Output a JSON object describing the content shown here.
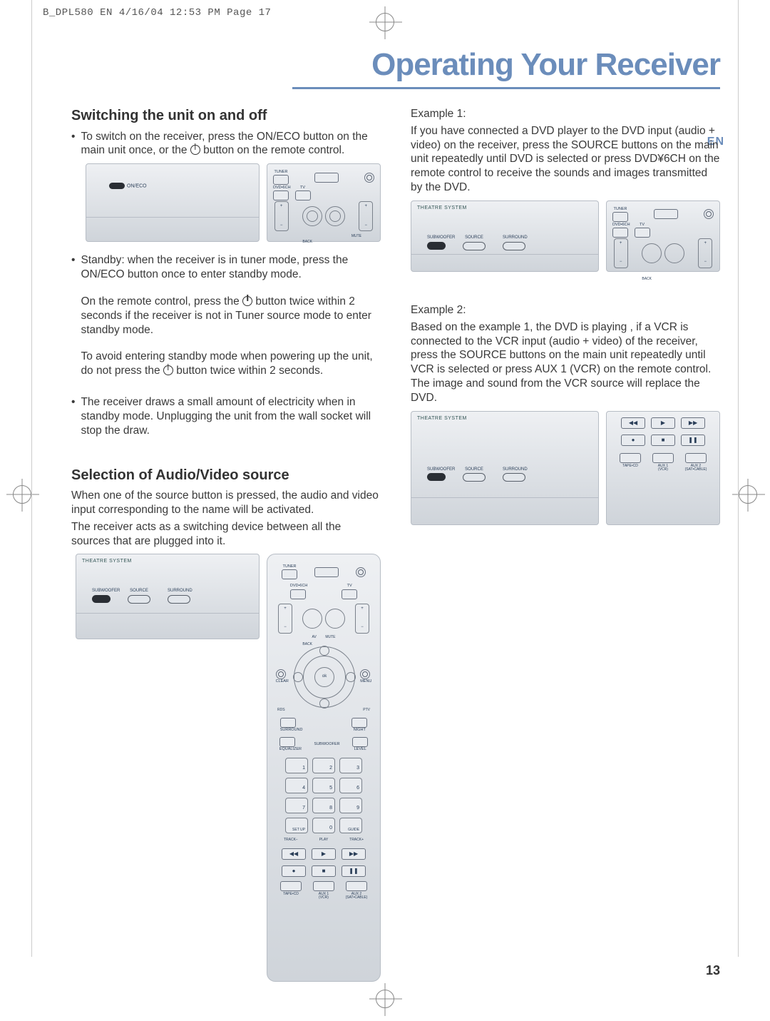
{
  "running_header": "B_DPL580  EN   4/16/04  12:53 PM  Page 17",
  "banner_title": "Operating Your Receiver",
  "lang_tag": "EN",
  "page_number": "13",
  "left": {
    "h1": "Switching the unit on and off",
    "b1": "To switch on the receiver, press the ON/ECO button on the main unit once, or the ",
    "b1_tail": " button on the remote control.",
    "b2": "Standby: when the receiver is in tuner mode, press the ON/ECO button once to enter standby mode.",
    "b2_p2": "On the remote control, press the ",
    "b2_p2_tail": " button twice within 2 seconds if the receiver is not in Tuner source mode to enter standby mode.",
    "b2_p3a": "To avoid entering standby mode when powering up the unit, do not press the ",
    "b2_p3b": " button twice within 2 seconds.",
    "b3": "The receiver draws a small amount of electricity when in standby mode. Unplugging the unit from the wall socket will stop the draw.",
    "h2": "Selection of Audio/Video source",
    "p1": "When one of the source button is pressed, the audio and video input corresponding to the name will be activated.",
    "p2": "The receiver acts as a switching device between all the sources that are plugged into it."
  },
  "right": {
    "ex1_label": "Example 1:",
    "ex1_text": "If you have connected a DVD player to the DVD input (audio + video) on the receiver, press the SOURCE buttons on the main unit repeatedly until DVD is selected or press DVD¥6CH on the remote control to receive the sounds and images transmitted by the DVD.",
    "ex2_label": "Example 2:",
    "ex2_text": "Based on the example 1, the DVD is playing , if a VCR is connected  to the VCR input (audio + video) of the receiver, press the SOURCE buttons on the main unit repeatedly until VCR is selected or press AUX 1 (VCR) on the remote control. The image and sound from the VCR source will replace the DVD."
  },
  "unit": {
    "system": "THEATRE SYSTEM",
    "on_eco": "ON/ECO",
    "subwoofer": "SUBWOOFER",
    "source": "SOURCE",
    "surround": "SURROUND"
  },
  "remote": {
    "tuner": "TUNER",
    "dvd6ch": "DVD•6CH",
    "tv": "TV",
    "back": "BACK",
    "mute": "MUTE",
    "av": "AV",
    "clear": "CLEAR",
    "menu": "MENU",
    "rds": "RDS",
    "ok": "ok",
    "ptv": "PTV",
    "surround": "SURROUND",
    "night": "NIGHT",
    "equalizer": "EQUALIZER",
    "subwoofer": "SUBWOOFER",
    "level": "LEVEL",
    "setup": "SET UP",
    "guide": "GUIDE",
    "num": [
      "1",
      "2",
      "3",
      "4",
      "5",
      "6",
      "7",
      "8",
      "9",
      "0"
    ],
    "track_prev": "TRACK−",
    "track_play": "PLAY",
    "track_next": "TRACK+",
    "rec": "●",
    "stop": "■",
    "pause": "❚❚",
    "rew": "◀◀",
    "play": "▶",
    "fwd": "▶▶",
    "aux_a": "TAPE•CD",
    "aux_b": "AUX 1\n(VCR)",
    "aux_c": "AUX 2\n(SAT•CABLE)"
  }
}
